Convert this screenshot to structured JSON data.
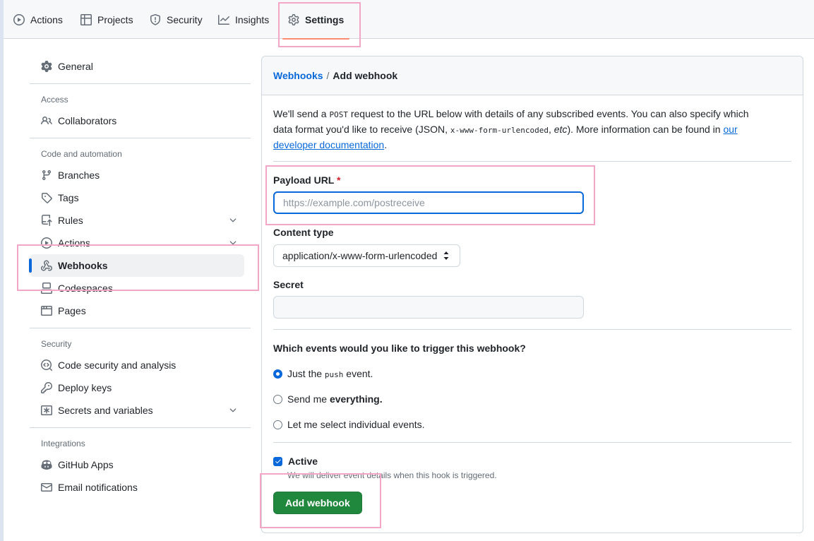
{
  "topnav": {
    "tabs": [
      {
        "label": "Actions",
        "icon": "play-icon"
      },
      {
        "label": "Projects",
        "icon": "table-icon"
      },
      {
        "label": "Security",
        "icon": "shield-icon"
      },
      {
        "label": "Insights",
        "icon": "graph-icon"
      },
      {
        "label": "Settings",
        "icon": "gear-icon",
        "active": true
      }
    ]
  },
  "sidebar": {
    "general": "General",
    "sections": {
      "access": "Access",
      "code_automation": "Code and automation",
      "security": "Security",
      "integrations": "Integrations"
    },
    "items": {
      "collaborators": "Collaborators",
      "branches": "Branches",
      "tags": "Tags",
      "rules": "Rules",
      "actions": "Actions",
      "webhooks": "Webhooks",
      "codespaces": "Codespaces",
      "pages": "Pages",
      "code_security": "Code security and analysis",
      "deploy_keys": "Deploy keys",
      "secrets": "Secrets and variables",
      "github_apps": "GitHub Apps",
      "email": "Email notifications"
    }
  },
  "panel": {
    "breadcrumb_link": "Webhooks",
    "breadcrumb_sep": "/",
    "breadcrumb_current": "Add webhook",
    "desc": {
      "p1": "We'll send a ",
      "code1": "POST",
      "p2": " request to the URL below with details of any subscribed events. You can also specify which data format you'd like to receive (JSON, ",
      "code2": "x-www-form-urlencoded",
      "p3": ", ",
      "etc": "etc",
      "p4": "). More information can be found in ",
      "link": "our developer documentation",
      "p5": "."
    },
    "payload_label": "Payload URL",
    "required_mark": "*",
    "payload_placeholder": "https://example.com/postreceive",
    "content_type_label": "Content type",
    "content_type_value": "application/x-www-form-urlencoded",
    "secret_label": "Secret",
    "events_question": "Which events would you like to trigger this webhook?",
    "event_push_a": "Just the ",
    "event_push_code": "push",
    "event_push_b": " event.",
    "event_all_a": "Send me ",
    "event_all_b": "everything.",
    "event_select": "Let me select individual events.",
    "active_label": "Active",
    "active_note": "We will deliver event details when this hook is triggered.",
    "submit": "Add webhook"
  },
  "colors": {
    "accent": "#0969da",
    "primary_button": "#1f883d",
    "active_tab_underline": "#fd8c73",
    "highlight_box": "#f4a6c6"
  }
}
